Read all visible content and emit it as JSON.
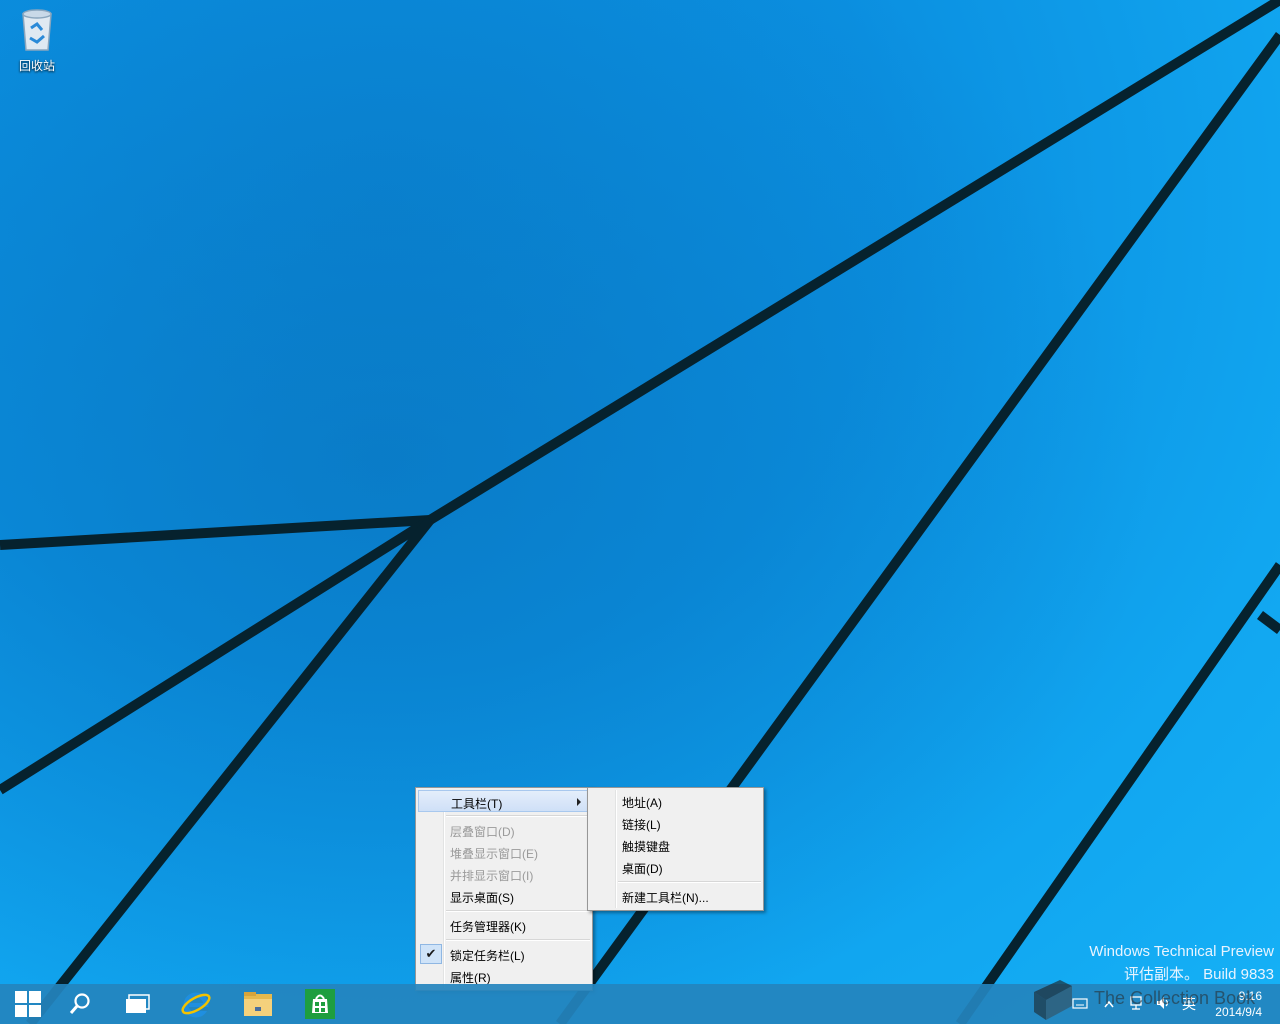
{
  "desktop": {
    "recycle_bin_label": "回收站"
  },
  "watermark": {
    "line1": "Windows Technical Preview",
    "line2": "评估副本。 Build 9833"
  },
  "context_menu": {
    "items": [
      {
        "label": "工具栏(T)",
        "has_submenu": true,
        "highlighted": true
      },
      {
        "label": "层叠窗口(D)",
        "disabled": true
      },
      {
        "label": "堆叠显示窗口(E)",
        "disabled": true
      },
      {
        "label": "并排显示窗口(I)",
        "disabled": true
      },
      {
        "label": "显示桌面(S)"
      },
      {
        "label": "任务管理器(K)"
      },
      {
        "label": "锁定任务栏(L)",
        "checked": true
      },
      {
        "label": "属性(R)"
      }
    ]
  },
  "toolbar_submenu": {
    "items": [
      {
        "label": "地址(A)"
      },
      {
        "label": "链接(L)"
      },
      {
        "label": "触摸键盘"
      },
      {
        "label": "桌面(D)"
      },
      {
        "label": "新建工具栏(N)..."
      }
    ]
  },
  "taskbar": {
    "pinned": [
      "start-icon",
      "search-icon",
      "task-view-icon",
      "internet-explorer-icon",
      "file-explorer-icon",
      "store-icon"
    ],
    "tray": {
      "language": "英",
      "time": "9:16",
      "date": "2014/9/4"
    },
    "overlay_logo_text": "The Collection Book"
  },
  "colors": {
    "accent": "#1a9fe8",
    "taskbar": "#2484be",
    "menu_bg": "#f0f0f0",
    "menu_highlight": "#cfe0f7"
  }
}
